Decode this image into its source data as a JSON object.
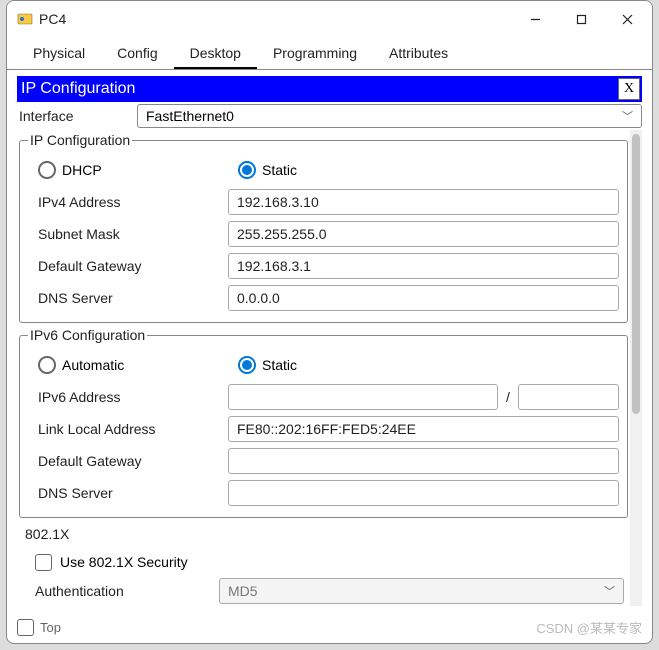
{
  "window": {
    "title": "PC4"
  },
  "tabs": {
    "items": [
      "Physical",
      "Config",
      "Desktop",
      "Programming",
      "Attributes"
    ],
    "active": "Desktop"
  },
  "ipconfig": {
    "title": "IP Configuration",
    "close_x": "X",
    "interface_label": "Interface",
    "interface_value": "FastEthernet0",
    "v4": {
      "legend": "IP Configuration",
      "radio_dhcp": "DHCP",
      "radio_static": "Static",
      "mode": "Static",
      "ipv4_label": "IPv4 Address",
      "ipv4_value": "192.168.3.10",
      "mask_label": "Subnet Mask",
      "mask_value": "255.255.255.0",
      "gw_label": "Default Gateway",
      "gw_value": "192.168.3.1",
      "dns_label": "DNS Server",
      "dns_value": "0.0.0.0"
    },
    "v6": {
      "legend": "IPv6 Configuration",
      "radio_auto": "Automatic",
      "radio_static": "Static",
      "mode": "Static",
      "addr_label": "IPv6 Address",
      "addr_value": "",
      "prefix_slash": "/",
      "prefix_value": "",
      "lla_label": "Link Local Address",
      "lla_value": "FE80::202:16FF:FED5:24EE",
      "gw_label": "Default Gateway",
      "gw_value": "",
      "dns_label": "DNS Server",
      "dns_value": ""
    },
    "dot1x": {
      "legend": "802.1X",
      "use_label": "Use 802.1X Security",
      "use_checked": false,
      "auth_label": "Authentication",
      "auth_value": "MD5"
    }
  },
  "bottom": {
    "top_checkbox_label": "Top"
  },
  "watermark": "CSDN @某某专家"
}
